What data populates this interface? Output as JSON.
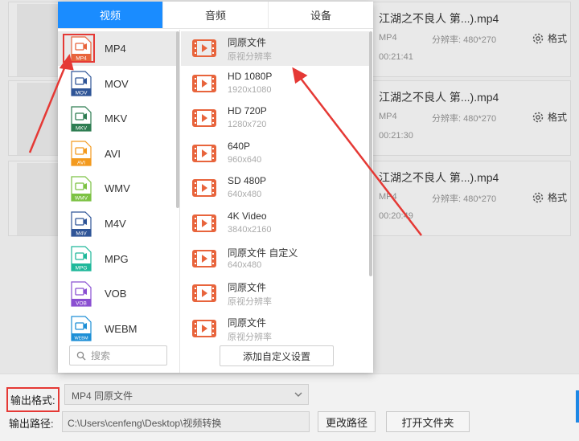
{
  "tabs": [
    {
      "label": "视频",
      "active": true
    },
    {
      "label": "音频",
      "active": false
    },
    {
      "label": "设备",
      "active": false
    }
  ],
  "formats": [
    {
      "ext": "MP4",
      "color": "#e8643c"
    },
    {
      "ext": "MOV",
      "color": "#2f5597"
    },
    {
      "ext": "MKV",
      "color": "#2e7d52"
    },
    {
      "ext": "AVI",
      "color": "#f39a1e"
    },
    {
      "ext": "WMV",
      "color": "#7cc243"
    },
    {
      "ext": "M4V",
      "color": "#2f5597"
    },
    {
      "ext": "MPG",
      "color": "#1fb89a"
    },
    {
      "ext": "VOB",
      "color": "#8a4fd1"
    },
    {
      "ext": "WEBM",
      "color": "#1d8fd6"
    }
  ],
  "search_placeholder": "搜索",
  "qualities": [
    {
      "title": "同原文件",
      "sub": "原视分辨率"
    },
    {
      "title": "HD 1080P",
      "sub": "1920x1080"
    },
    {
      "title": "HD 720P",
      "sub": "1280x720"
    },
    {
      "title": "640P",
      "sub": "960x640"
    },
    {
      "title": "SD 480P",
      "sub": "640x480"
    },
    {
      "title": "4K Video",
      "sub": "3840x2160"
    },
    {
      "title": "同原文件 自定义",
      "sub": "640x480"
    },
    {
      "title": "同原文件",
      "sub": "原视分辨率"
    },
    {
      "title": "同原文件",
      "sub": "原视分辨率"
    }
  ],
  "add_custom_label": "添加自定义设置",
  "files": [
    {
      "name": "江湖之不良人 第...).mp4",
      "fmt": "MP4",
      "res": "分辨率: 480*270",
      "dur": "00:21:41",
      "settings": "格式"
    },
    {
      "name": "江湖之不良人 第...).mp4",
      "fmt": "MP4",
      "res": "分辨率: 480*270",
      "dur": "00:21:30",
      "settings": "格式"
    },
    {
      "name": "江湖之不良人 第...).mp4",
      "fmt": "MP4",
      "res": "分辨率: 480*270",
      "dur": "00:20:49",
      "settings": "格式"
    }
  ],
  "bottom": {
    "format_label": "输出格式:",
    "format_value": "MP4  同原文件",
    "path_label": "输出路径:",
    "path_value": "C:\\Users\\cenfeng\\Desktop\\视频转换",
    "change_path": "更改路径",
    "open_folder": "打开文件夹"
  },
  "colors": {
    "accent": "#1a8cff",
    "annotation": "#e53935",
    "video_icon": "#e8643c"
  }
}
